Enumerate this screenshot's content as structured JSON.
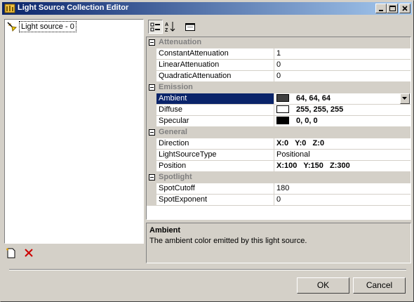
{
  "window": {
    "title": "Light Source Collection Editor",
    "controls": [
      "minimize-icon",
      "maximize-icon",
      "close-icon"
    ]
  },
  "list": {
    "items": [
      {
        "label": "Light source - 0",
        "icon": "light-source-icon",
        "selected": true
      }
    ],
    "add_icon": "new-item-icon",
    "delete_icon": "delete-x-icon",
    "colors": {
      "delete": "#cc0000"
    }
  },
  "toolbar": {
    "buttons": [
      "categorized-icon",
      "alphabetical-icon",
      "property-pages-icon"
    ]
  },
  "grid": {
    "categories": [
      {
        "name": "Attenuation",
        "properties": [
          {
            "name": "ConstantAttenuation",
            "value": "1"
          },
          {
            "name": "LinearAttenuation",
            "value": "0"
          },
          {
            "name": "QuadraticAttenuation",
            "value": "0"
          }
        ]
      },
      {
        "name": "Emission",
        "properties": [
          {
            "name": "Ambient",
            "value": "64, 64, 64",
            "swatch": "#404040",
            "selected": true,
            "bold": true
          },
          {
            "name": "Diffuse",
            "value": "255, 255, 255",
            "swatch": "#ffffff",
            "bold": true
          },
          {
            "name": "Specular",
            "value": "0, 0, 0",
            "swatch": "#000000",
            "bold": true
          }
        ]
      },
      {
        "name": "General",
        "properties": [
          {
            "name": "Direction",
            "value": "X:0   Y:0   Z:0",
            "bold": true
          },
          {
            "name": "LightSourceType",
            "value": "Positional"
          },
          {
            "name": "Position",
            "value": "X:100   Y:150   Z:300",
            "bold": true
          }
        ]
      },
      {
        "name": "Spotlight",
        "properties": [
          {
            "name": "SpotCutoff",
            "value": "180"
          },
          {
            "name": "SpotExponent",
            "value": "0"
          }
        ]
      }
    ]
  },
  "description": {
    "title": "Ambient",
    "text": "The ambient color emitted by this light source."
  },
  "buttons": {
    "ok": "OK",
    "cancel": "Cancel"
  },
  "colors": {
    "titlebar_start": "#0a246a",
    "titlebar_end": "#a6caf0",
    "face": "#d4d0c8",
    "selection": "#0a246a"
  }
}
